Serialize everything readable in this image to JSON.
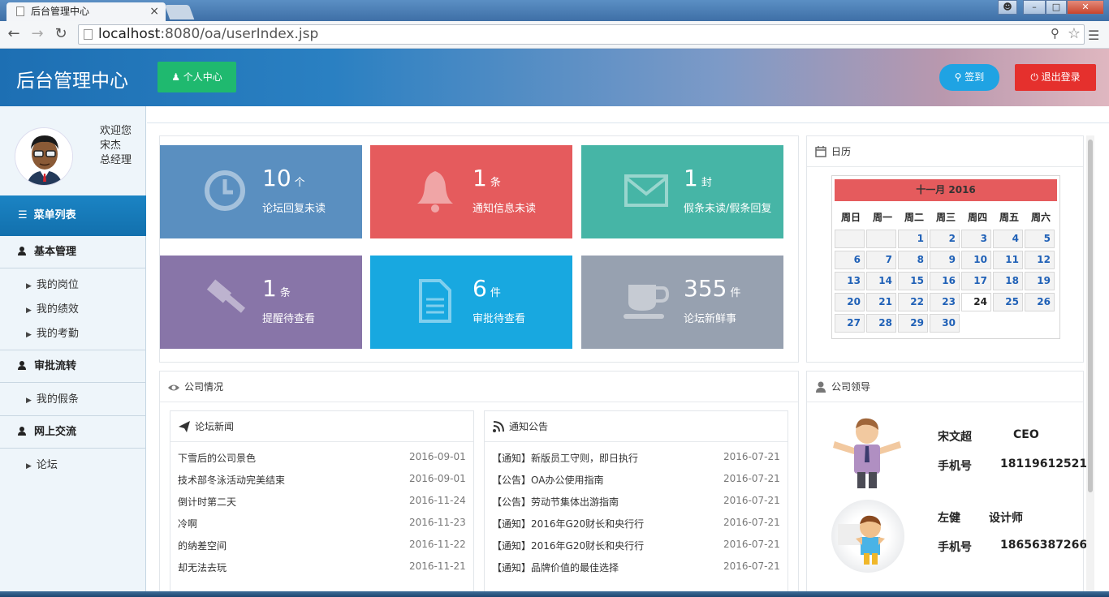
{
  "browser": {
    "tab_title": "后台管理中心",
    "tab_close": "×",
    "url_host": "localhost",
    "url_path": ":8080/oa/userIndex.jsp"
  },
  "header": {
    "title": "后台管理中心",
    "profile_button": "个人中心",
    "sign_button": "签到",
    "logout_button": "退出登录"
  },
  "sidebar": {
    "welcome": "欢迎您",
    "user_name": "宋杰",
    "user_role": "总经理",
    "menu_title": "菜单列表",
    "groups": [
      {
        "label": "基本管理",
        "items": [
          "我的岗位",
          "我的绩效",
          "我的考勤"
        ]
      },
      {
        "label": "审批流转",
        "items": [
          "我的假条"
        ]
      },
      {
        "label": "网上交流",
        "items": [
          "论坛"
        ]
      }
    ]
  },
  "tiles": [
    {
      "num": "10",
      "unit": "个",
      "label": "论坛回复未读",
      "color": "#5a8fc0",
      "icon": "clock-icon"
    },
    {
      "num": "1",
      "unit": "条",
      "label": "通知信息未读",
      "color": "#e55b5d",
      "icon": "bell-icon"
    },
    {
      "num": "1",
      "unit": "封",
      "label": "假条未读/假条回复",
      "color": "#46b5a6",
      "icon": "envelope-icon"
    },
    {
      "num": "1",
      "unit": "条",
      "label": "提醒待查看",
      "color": "#8875a8",
      "icon": "gavel-icon"
    },
    {
      "num": "6",
      "unit": "件",
      "label": "审批待查看",
      "color": "#18a8e0",
      "icon": "document-icon"
    },
    {
      "num": "355",
      "unit": "件",
      "label": "论坛新鲜事",
      "color": "#97a1b0",
      "icon": "coffee-cup-icon"
    }
  ],
  "calendar": {
    "panel_title": "日历",
    "month_label": "十一月 2016",
    "weekdays": [
      "周日",
      "周一",
      "周二",
      "周三",
      "周四",
      "周五",
      "周六"
    ],
    "weeks": [
      [
        "",
        "",
        "1",
        "2",
        "3",
        "4",
        "5"
      ],
      [
        "6",
        "7",
        "8",
        "9",
        "10",
        "11",
        "12"
      ],
      [
        "13",
        "14",
        "15",
        "16",
        "17",
        "18",
        "19"
      ],
      [
        "20",
        "21",
        "22",
        "23",
        "24",
        "25",
        "26"
      ],
      [
        "27",
        "28",
        "29",
        "30",
        "",
        "",
        ""
      ]
    ],
    "today": "24"
  },
  "company": {
    "panel_title": "公司情况",
    "forum": {
      "title": "论坛新闻",
      "items": [
        {
          "title": "下雪后的公司景色",
          "date": "2016-09-01"
        },
        {
          "title": "技术部冬泳活动完美结束",
          "date": "2016-09-01"
        },
        {
          "title": "倒计时第二天",
          "date": "2016-11-24"
        },
        {
          "title": "冷啊",
          "date": "2016-11-23"
        },
        {
          "title": "的纳差空间",
          "date": "2016-11-22"
        },
        {
          "title": "却无法去玩",
          "date": "2016-11-21"
        }
      ]
    },
    "notice": {
      "title": "通知公告",
      "items": [
        {
          "title": "【通知】新版员工守则，即日执行",
          "date": "2016-07-21"
        },
        {
          "title": "【公告】OA办公使用指南",
          "date": "2016-07-21"
        },
        {
          "title": "【公告】劳动节集体出游指南",
          "date": "2016-07-21"
        },
        {
          "title": "【通知】2016年G20财长和央行行",
          "date": "2016-07-21"
        },
        {
          "title": "【通知】2016年G20财长和央行行",
          "date": "2016-07-21"
        },
        {
          "title": "【通知】品牌价值的最佳选择",
          "date": "2016-07-21"
        }
      ]
    }
  },
  "leaders": {
    "panel_title": "公司领导",
    "phone_label": "手机号",
    "people": [
      {
        "name": "宋文超",
        "title": "CEO",
        "phone": "18119612521"
      },
      {
        "name": "左健",
        "title": "设计师",
        "phone": "18656387266"
      }
    ]
  }
}
